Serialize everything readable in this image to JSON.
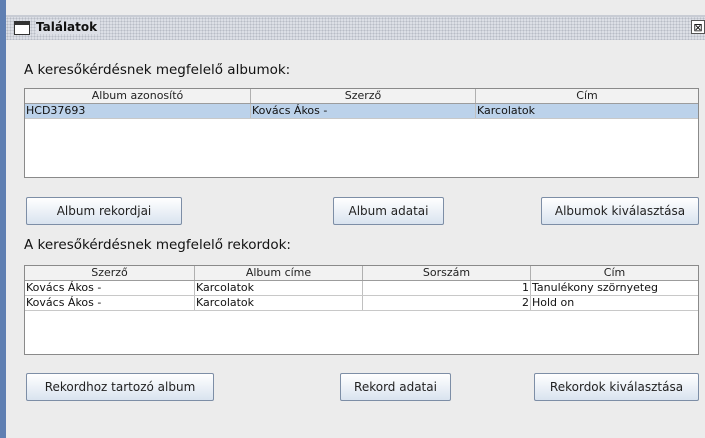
{
  "window": {
    "title": "Találatok",
    "close_glyph": "⊠"
  },
  "albums_section": {
    "heading": "A keresőkérdésnek megfelelő albumok:",
    "columns": [
      "Album azonosító",
      "Szerző",
      "Cím"
    ],
    "rows": [
      [
        "HCD37693",
        "Kovács Ákos -",
        "Karcolatok"
      ]
    ]
  },
  "album_buttons": {
    "records": "Album rekordjai",
    "details": "Album adatai",
    "select": "Albumok kiválasztása"
  },
  "records_section": {
    "heading": "A keresőkérdésnek megfelelő rekordok:",
    "columns": [
      "Szerző",
      "Album címe",
      "Sorszám",
      "Cím"
    ],
    "rows": [
      [
        "Kovács Ákos -",
        "Karcolatok",
        "1",
        "Tanulékony szörnyeteg"
      ],
      [
        "Kovács Ákos -",
        "Karcolatok",
        "2",
        "Hold on"
      ]
    ]
  },
  "record_buttons": {
    "album": "Rekordhoz tartozó album",
    "details": "Rekord adatai",
    "select": "Rekordok kiválasztása"
  },
  "colors": {
    "selection": "#bcd2ea",
    "border_blue": "#5f7fb2"
  }
}
